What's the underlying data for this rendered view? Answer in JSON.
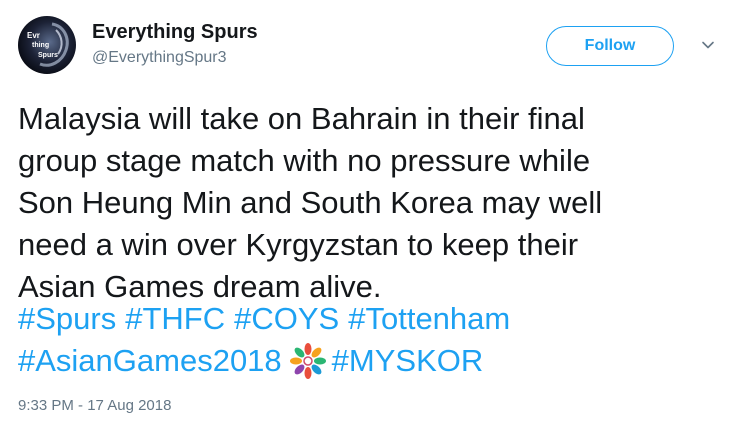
{
  "account": {
    "name": "Everything Spurs",
    "handle": "@EverythingSpur3",
    "avatar_text": [
      "Evr",
      "thing",
      "Spurs"
    ]
  },
  "actions": {
    "follow_label": "Follow",
    "menu_icon": "chevron-down-icon"
  },
  "tweet": {
    "lines": [
      "Malaysia will take on Bahrain in their final",
      "group stage match with no pressure while",
      "Son Heung Min and South Korea may well",
      "need a win over Kyrgyzstan to keep their",
      "Asian Games dream alive."
    ],
    "hashtags": [
      "#Spurs",
      "#THFC",
      "#COYS",
      "#Tottenham",
      "#AsianGames2018",
      "#MYSKOR"
    ],
    "emoji": "asian-games-emblem-icon"
  },
  "meta": {
    "timestamp": "9:33 PM - 17 Aug 2018"
  },
  "colors": {
    "link": "#1da1f2",
    "text": "#14171a",
    "muted": "#657786",
    "background": "#ffffff"
  }
}
